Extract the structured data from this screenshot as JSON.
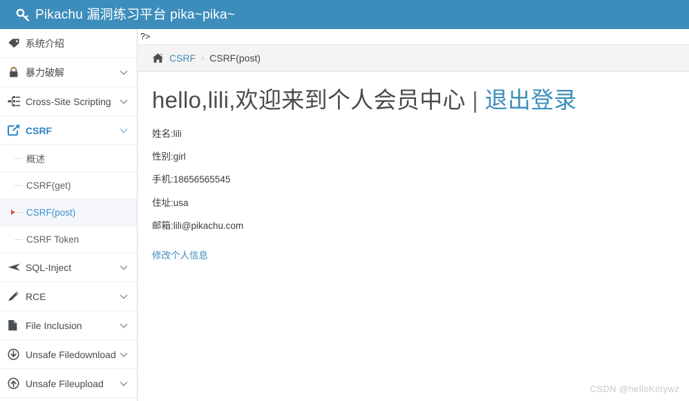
{
  "header": {
    "icon": "key-icon",
    "title": "Pikachu 漏洞练习平台 pika~pika~",
    "background": "#3c8dbc"
  },
  "sidebar": {
    "items": [
      {
        "label": "系统介绍",
        "icon": "tag-icon",
        "expandable": false,
        "active": false
      },
      {
        "label": "暴力破解",
        "icon": "lock-icon",
        "expandable": true,
        "active": false
      },
      {
        "label": "Cross-Site Scripting",
        "icon": "sitemap-icon",
        "expandable": true,
        "active": false
      },
      {
        "label": "CSRF",
        "icon": "share-square-icon",
        "expandable": true,
        "active": true
      },
      {
        "label": "SQL-Inject",
        "icon": "paper-plane-icon",
        "expandable": true,
        "active": false
      },
      {
        "label": "RCE",
        "icon": "pencil-icon",
        "expandable": true,
        "active": false
      },
      {
        "label": "File Inclusion",
        "icon": "file-icon",
        "expandable": true,
        "active": false
      },
      {
        "label": "Unsafe Filedownload",
        "icon": "arrow-circle-down-icon",
        "expandable": true,
        "active": false
      },
      {
        "label": "Unsafe Fileupload",
        "icon": "arrow-circle-up-icon",
        "expandable": true,
        "active": false
      }
    ],
    "submenu": [
      {
        "label": "概述",
        "active": false
      },
      {
        "label": "CSRF(get)",
        "active": false
      },
      {
        "label": "CSRF(post)",
        "active": true
      },
      {
        "label": "CSRF Token",
        "active": false
      }
    ],
    "accent_color": "#3c8dbc",
    "active_marker_color": "#3079ad",
    "bullet_color": "#d9534f"
  },
  "content": {
    "php_leak": "?>",
    "breadcrumb": {
      "home_icon": "home-icon",
      "link": "CSRF",
      "separator": "›",
      "current": "CSRF(post)"
    },
    "member": {
      "greeting": "hello,lili,欢迎来到个人会员中心",
      "divider": "|",
      "logout_label": "退出登录",
      "fields": [
        {
          "label": "姓名",
          "value": "lili",
          "text": "姓名:lili"
        },
        {
          "label": "性别",
          "value": "girl",
          "text": "性别:girl"
        },
        {
          "label": "手机",
          "value": "18656565545",
          "text": "手机:18656565545"
        },
        {
          "label": "住址",
          "value": "usa",
          "text": "住址:usa"
        },
        {
          "label": "邮箱",
          "value": "lili@pikachu.com",
          "text": "邮箱:lili@pikachu.com"
        }
      ],
      "edit_label": "修改个人信息"
    }
  },
  "watermark": "CSDN @helloKittywz"
}
